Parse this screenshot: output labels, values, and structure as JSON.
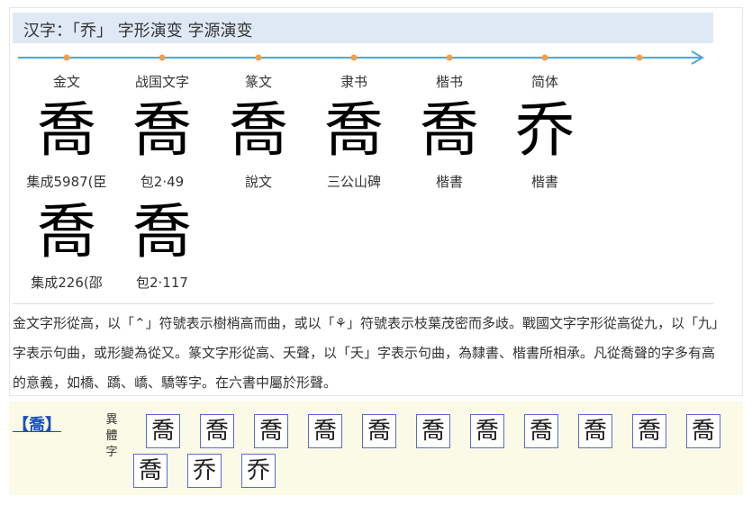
{
  "header": {
    "title": "汉字：「乔」 字形演变 字源演变"
  },
  "evolution": {
    "stages": [
      "金文",
      "战国文字",
      "篆文",
      "隶书",
      "楷书",
      "简体"
    ],
    "row1": [
      {
        "glyph": "喬",
        "caption": "集成5987(臣"
      },
      {
        "glyph": "喬",
        "caption": "包2·49"
      },
      {
        "glyph": "喬",
        "caption": "說文"
      },
      {
        "glyph": "喬",
        "caption": "三公山碑"
      },
      {
        "glyph": "喬",
        "caption": "楷書"
      },
      {
        "glyph": "乔",
        "caption": "楷書"
      }
    ],
    "row2": [
      {
        "glyph": "喬",
        "caption": "集成226(邵"
      },
      {
        "glyph": "喬",
        "caption": "包2·117"
      }
    ]
  },
  "description": "金文字形從高，以「⌃」符號表示樹梢高而曲，或以「⚘」符號表示枝葉茂密而多歧。戰國文字字形從高從九，以「九」字表示句曲，或形變為從又。篆文字形從高、夭聲，以「夭」字表示句曲，為隸書、楷書所相承。凡從喬聲的字多有高的意義，如橋、蹻、嶠、驕等字。在六書中屬於形聲。",
  "variants_section": {
    "head": "【喬】",
    "label": "異體字",
    "chars": [
      "喬",
      "喬",
      "喬",
      "喬",
      "喬",
      "喬",
      "喬",
      "喬",
      "喬",
      "喬",
      "喬",
      "喬",
      "乔",
      "乔"
    ]
  },
  "colors": {
    "timeline": "#4aa8d8",
    "dots": "#f0a050",
    "accent": "#1a4fbf"
  }
}
